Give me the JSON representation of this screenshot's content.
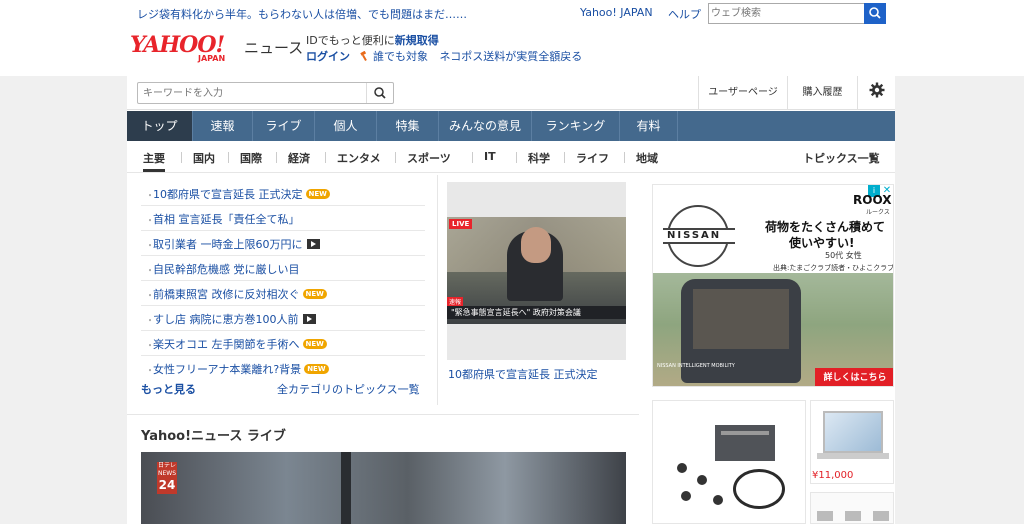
{
  "topbar": {
    "message": "レジ袋有料化から半年。もらわない人は倍増、でも問題はまだ……",
    "links": [
      "Yahoo! JAPAN",
      "ヘルプ"
    ],
    "web_search_placeholder": "ウェブ検索"
  },
  "header": {
    "logo_text": "YAHOO!",
    "logo_sub": "JAPAN",
    "site_name": "ニュース",
    "promo_text": "IDでもっと便利に",
    "promo_link": "新規取得",
    "login": "ログイン",
    "campaign": "誰でも対象",
    "campaign_detail": "ネコポス送料が実質全額戻る"
  },
  "search": {
    "placeholder": "キーワードを入力",
    "user_page": "ユーザーページ",
    "history": "購入履歴"
  },
  "nav": {
    "items": [
      "トップ",
      "速報",
      "ライブ",
      "個人",
      "特集",
      "みんなの意見",
      "ランキング",
      "有料"
    ],
    "active": "トップ"
  },
  "subnav": {
    "items": [
      "主要",
      "国内",
      "国際",
      "経済",
      "エンタメ",
      "スポーツ",
      "IT",
      "科学",
      "ライフ",
      "地域"
    ],
    "active": "主要",
    "all_topics": "トピックス一覧"
  },
  "topics": [
    {
      "title": "10都府県で宣言延長 正式決定",
      "badge": "new"
    },
    {
      "title": "首相 宣言延長「責任全て私」",
      "badge": ""
    },
    {
      "title": "取引業者 一時金上限60万円に",
      "badge": "video"
    },
    {
      "title": "自民幹部危機感 党に厳しい目",
      "badge": ""
    },
    {
      "title": "前橋東照宮 改修に反対相次ぐ",
      "badge": "new"
    },
    {
      "title": "すし店 病院に恵方巻100人前",
      "badge": "video"
    },
    {
      "title": "楽天オコエ 左手関節を手術へ",
      "badge": "new"
    },
    {
      "title": "女性フリーアナ本業離れ?背景",
      "badge": "new"
    }
  ],
  "badges": {
    "new": "NEW"
  },
  "more": "もっと見る",
  "all_categories": "全カテゴリのトピックス一覧",
  "pickup": {
    "live_tag": "LIVE",
    "tag": "速報",
    "ticker": "\"緊急事態宣言延長へ\" 政府対策会議",
    "caption": "10都府県で宣言延長 正式決定"
  },
  "live_section": {
    "title": "Yahoo!ニュース ライブ",
    "channel_logo_top": "日テレ NEWS",
    "channel_logo_num": "24"
  },
  "ad_main": {
    "brand": "NISSAN",
    "model": "ROOX",
    "model_kana": "ルークス",
    "headline_1": "荷物をたくさん積めて",
    "headline_2": "使いやすい!",
    "age": "50代 女性",
    "source": "出典:たまごクラブ読者・ひよこクラブ読者",
    "badge_text": "NISSAN INTELLIGENT MOBILITY",
    "cta": "詳しくはこちら"
  },
  "ad_side": {
    "price": "¥11,000"
  }
}
